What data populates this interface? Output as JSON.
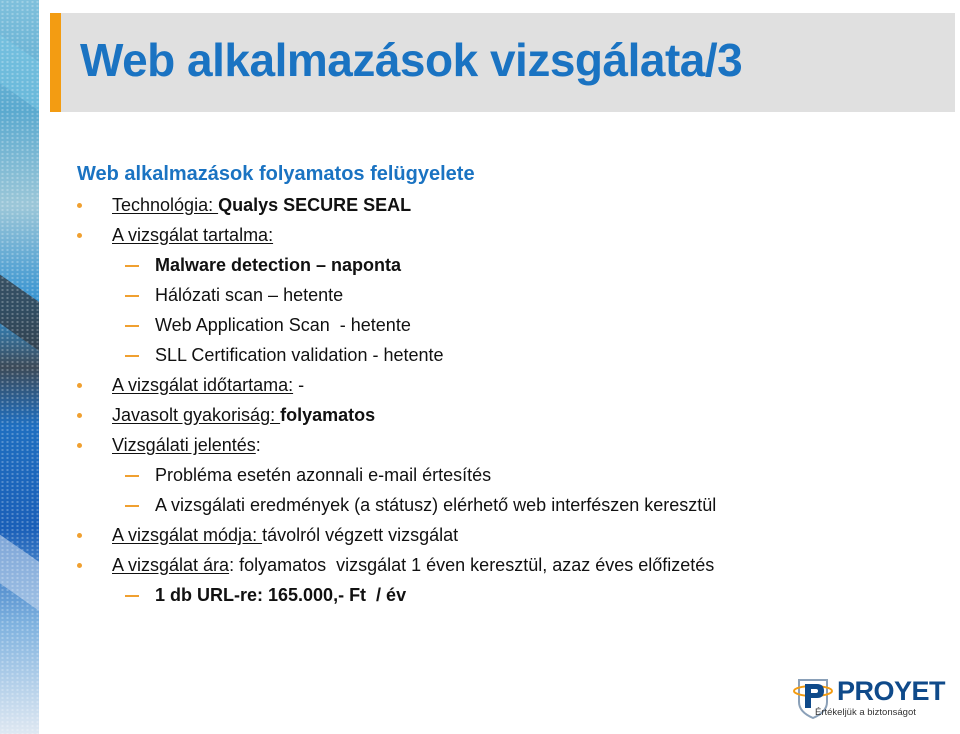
{
  "slide": {
    "title": "Web alkalmazások vizsgálata/3",
    "subheading": "Web alkalmazások folyamatos felügyelete",
    "items": [
      {
        "level": 1,
        "label": "Technológia: ",
        "value": "Qualys SECURE SEAL"
      },
      {
        "level": 1,
        "label": "A vizsgálat tartalma:",
        "value": ""
      },
      {
        "level": 2,
        "text": "Malware detection – naponta"
      },
      {
        "level": 2,
        "text": "Hálózati scan – hetente"
      },
      {
        "level": 2,
        "text": "Web Application Scan  - hetente"
      },
      {
        "level": 2,
        "text": "SLL Certification validation - hetente"
      },
      {
        "level": 1,
        "label": "A vizsgálat időtartama:",
        "value": " -"
      },
      {
        "level": 1,
        "label": "Javasolt gyakoriság: ",
        "value": "folyamatos"
      },
      {
        "level": 1,
        "label": "Vizsgálati jelentés",
        "value": ":"
      },
      {
        "level": 2,
        "text": "Probléma esetén azonnali e-mail értesítés"
      },
      {
        "level": 2,
        "text": "A vizsgálati eredmények (a státusz) elérhető web interfészen keresztül"
      },
      {
        "level": 1,
        "label": "A vizsgálat módja: ",
        "value": "távolról végzett vizsgálat"
      },
      {
        "level": 1,
        "label": "A vizsgálat ára",
        "value": ": folyamatos  vizsgálat 1 éven keresztül, azaz éves előfizetés"
      },
      {
        "level": 2,
        "text": "1 db URL-re: 165.000,- Ft  / év"
      }
    ]
  },
  "logo": {
    "name": "PROYET",
    "tagline": "Értékeljük a biztonságot",
    "icon": "shield-p-icon"
  },
  "colors": {
    "title": "#1a73c2",
    "accent": "#f39c12",
    "title_bar": "#e0e0e0",
    "logo": "#0f4a8a"
  }
}
